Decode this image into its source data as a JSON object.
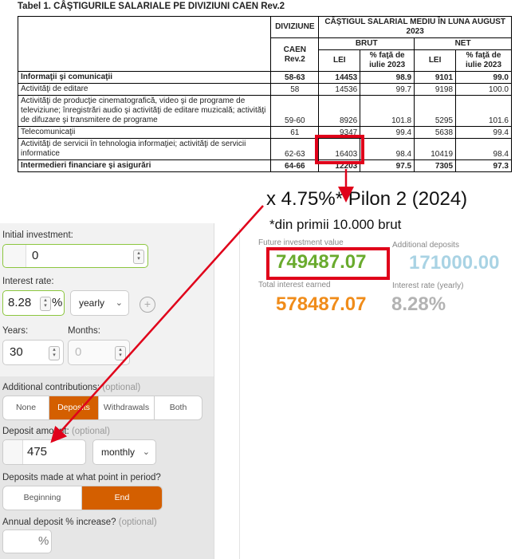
{
  "table": {
    "title": "Tabel 1. CÂŞTIGURILE SALARIALE PE DIVIZIUNI CAEN Rev.2",
    "headers": {
      "diviziune": "DIVIZIUNE",
      "caen": "CAEN Rev.2",
      "castig": "CÂŞTIGUL SALARIAL MEDIU ÎN LUNA AUGUST 2023",
      "brut": "BRUT",
      "net": "NET",
      "lei": "LEI",
      "fata": "% faţă de iulie 2023"
    },
    "rows": [
      {
        "name": "Informaţii şi comunicaţii",
        "caen": "58-63",
        "brut_lei": "14453",
        "brut_pct": "98.9",
        "net_lei": "9101",
        "net_pct": "99.0",
        "bold": true
      },
      {
        "name": "Activităţi de editare",
        "caen": "58",
        "brut_lei": "14536",
        "brut_pct": "99.7",
        "net_lei": "9198",
        "net_pct": "100.0",
        "bold": false
      },
      {
        "name": "Activităţi de producţie cinematografică, video şi de programe de televiziune; înregistrări audio şi activităţi de editare muzicală; activităţi de difuzare şi transmitere de programe",
        "caen": "59-60",
        "brut_lei": "8926",
        "brut_pct": "101.8",
        "net_lei": "5295",
        "net_pct": "101.6",
        "bold": false
      },
      {
        "name": "Telecomunicaţii",
        "caen": "61",
        "brut_lei": "9347",
        "brut_pct": "99.4",
        "net_lei": "5638",
        "net_pct": "99.4",
        "bold": false
      },
      {
        "name": "Activităţi de servicii în tehnologia informaţiei; activităţi de servicii informatice",
        "caen": "62-63",
        "brut_lei": "16403",
        "brut_pct": "98.4",
        "net_lei": "10419",
        "net_pct": "98.4",
        "bold": false
      },
      {
        "name": "Intermedieri financiare şi asigurări",
        "caen": "64-66",
        "brut_lei": "12203",
        "brut_pct": "97.5",
        "net_lei": "7305",
        "net_pct": "97.3",
        "bold": true
      }
    ]
  },
  "annotations": {
    "multiplier": "x 4.75%* Pilon 2 (2024)",
    "footnote": "*din primii 10.000 brut",
    "accent_color": "#e0001a"
  },
  "calculator": {
    "initial_label": "Initial investment:",
    "initial_value": "0",
    "rate_label": "Interest rate:",
    "rate_value": "8.28",
    "rate_suffix": "%",
    "rate_period": "yearly",
    "years_label": "Years:",
    "years_value": "30",
    "months_label": "Months:",
    "months_value": "0",
    "contrib_label": "Additional contributions:",
    "contrib_optional": "(optional)",
    "contrib_options": [
      "None",
      "Deposits",
      "Withdrawals",
      "Both"
    ],
    "contrib_selected": "Deposits",
    "deposit_label": "Deposit amount:",
    "deposit_optional": "(optional)",
    "deposit_value": "475",
    "deposit_period": "monthly",
    "timing_label": "Deposits made at what point in period?",
    "timing_options": [
      "Beginning",
      "End"
    ],
    "timing_selected": "End",
    "increase_label": "Annual deposit % increase?",
    "increase_optional": "(optional)",
    "increase_suffix": "%",
    "active_color": "#d45f00"
  },
  "results": {
    "future_label": "Future investment value",
    "future_value": "749487.07",
    "deposits_label": "Additional deposits",
    "deposits_value": "171000.00",
    "interest_label": "Total interest earned",
    "interest_value": "578487.07",
    "rate_label": "Interest rate (yearly)",
    "rate_value": "8.28%",
    "colors": {
      "future": "#6aab2e",
      "deposits": "#a9d3e4",
      "interest": "#f08c1a",
      "rate": "#b3b3b3"
    }
  }
}
